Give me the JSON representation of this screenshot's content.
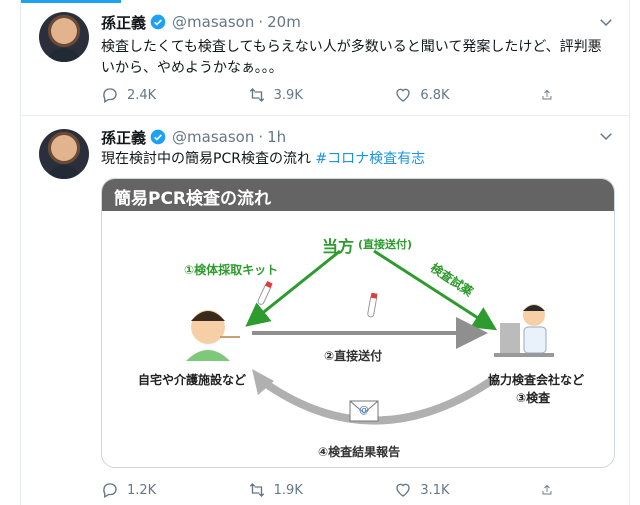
{
  "tweets": [
    {
      "name": "孫正義",
      "handle": "@masason",
      "dot": "·",
      "time": "20m",
      "text": "検査したくても検査してもらえない人が多数いると聞いて発案したけど、評判悪いから、やめようかなぁ。。。",
      "replies": "2.4K",
      "retweets": "3.9K",
      "likes": "6.8K"
    },
    {
      "name": "孫正義",
      "handle": "@masason",
      "dot": "·",
      "time": "1h",
      "text": "現在検討中の簡易PCR検査の流れ ",
      "hashtag": "#コロナ検査有志",
      "replies": "1.2K",
      "retweets": "1.9K",
      "likes": "3.1K",
      "card": {
        "title": "簡易PCR検査の流れ",
        "top_party": "当方",
        "top_party_note": "(直接送付)",
        "step1": "①検体採取キット",
        "step_right": "検査試薬",
        "step2": "②直接送付",
        "left_party": "自宅や介護施設など",
        "right_party": "協力検査会社など",
        "step3": "③検査",
        "step4": "④検査結果報告"
      }
    }
  ],
  "colors": {
    "accent": "#1da1f2",
    "green": "#2e9b2e",
    "grey_arrow": "#9a9a9a",
    "muted": "#657786"
  },
  "icons": [
    "verified-badge-icon",
    "chevron-down-icon",
    "reply-icon",
    "retweet-icon",
    "like-icon",
    "share-icon",
    "mail-icon",
    "test-tube-icon"
  ]
}
